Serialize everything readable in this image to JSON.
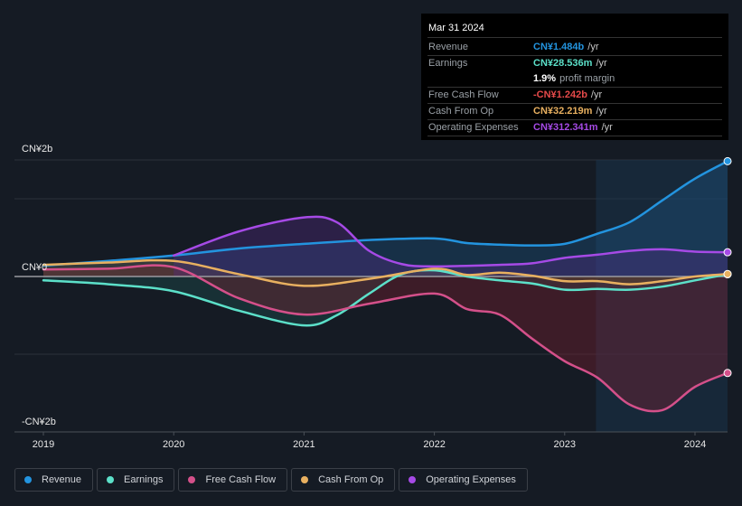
{
  "tooltip": {
    "date": "Mar 31 2024",
    "rows": [
      {
        "label": "Revenue",
        "value": "CN¥1.484b",
        "unit": "/yr",
        "color": "#2394df"
      },
      {
        "label": "Earnings",
        "value": "CN¥28.536m",
        "unit": "/yr",
        "color": "#5ce0c9"
      },
      {
        "label": "",
        "value": "1.9%",
        "unit": "profit margin",
        "color": "#ffffff"
      },
      {
        "label": "Free Cash Flow",
        "value": "-CN¥1.242b",
        "unit": "/yr",
        "color": "#e64a4a"
      },
      {
        "label": "Cash From Op",
        "value": "CN¥32.219m",
        "unit": "/yr",
        "color": "#e8b060"
      },
      {
        "label": "Operating Expenses",
        "value": "CN¥312.341m",
        "unit": "/yr",
        "color": "#a64ae6"
      }
    ]
  },
  "legend": [
    {
      "label": "Revenue",
      "color": "#2394df"
    },
    {
      "label": "Earnings",
      "color": "#5ce0c9"
    },
    {
      "label": "Free Cash Flow",
      "color": "#d4508a"
    },
    {
      "label": "Cash From Op",
      "color": "#e8b060"
    },
    {
      "label": "Operating Expenses",
      "color": "#a64ae6"
    }
  ],
  "chart_data": {
    "type": "area",
    "title": "",
    "xlabel": "",
    "ylabel": "",
    "y_unit": "CN¥ billions",
    "ylim": [
      -2,
      1.5
    ],
    "y_tick_labels": [
      {
        "value": 1.5,
        "label": "CN¥2b"
      },
      {
        "value": 0,
        "label": "CN¥0"
      },
      {
        "value": -2,
        "label": "-CN¥2b"
      }
    ],
    "gridlines": [
      1.5,
      1,
      0,
      -1,
      -2
    ],
    "x_ticks": [
      2019,
      2020,
      2021,
      2022,
      2023,
      2024
    ],
    "xlim": [
      2019,
      2024.25
    ],
    "forecast_shade_start": 2023.24,
    "series": [
      {
        "name": "Revenue",
        "color": "#2394df",
        "points": [
          [
            2019,
            0.14
          ],
          [
            2019.5,
            0.2
          ],
          [
            2020,
            0.27
          ],
          [
            2020.5,
            0.36
          ],
          [
            2021,
            0.42
          ],
          [
            2021.5,
            0.47
          ],
          [
            2022,
            0.49
          ],
          [
            2022.25,
            0.43
          ],
          [
            2022.5,
            0.41
          ],
          [
            2022.75,
            0.4
          ],
          [
            2023,
            0.42
          ],
          [
            2023.25,
            0.55
          ],
          [
            2023.5,
            0.7
          ],
          [
            2023.75,
            0.98
          ],
          [
            2024,
            1.26
          ],
          [
            2024.25,
            1.484
          ]
        ]
      },
      {
        "name": "Earnings",
        "color": "#5ce0c9",
        "points": [
          [
            2019,
            -0.05
          ],
          [
            2019.5,
            -0.1
          ],
          [
            2020,
            -0.19
          ],
          [
            2020.5,
            -0.44
          ],
          [
            2021,
            -0.63
          ],
          [
            2021.25,
            -0.5
          ],
          [
            2021.5,
            -0.22
          ],
          [
            2021.75,
            0.03
          ],
          [
            2022,
            0.08
          ],
          [
            2022.25,
            0.0
          ],
          [
            2022.5,
            -0.05
          ],
          [
            2022.75,
            -0.09
          ],
          [
            2023,
            -0.17
          ],
          [
            2023.25,
            -0.16
          ],
          [
            2023.5,
            -0.17
          ],
          [
            2023.75,
            -0.13
          ],
          [
            2024,
            -0.05
          ],
          [
            2024.25,
            0.0285
          ]
        ]
      },
      {
        "name": "Free Cash Flow",
        "color": "#d4508a",
        "points": [
          [
            2019,
            0.09
          ],
          [
            2019.5,
            0.1
          ],
          [
            2020,
            0.12
          ],
          [
            2020.5,
            -0.28
          ],
          [
            2021,
            -0.49
          ],
          [
            2021.5,
            -0.35
          ],
          [
            2022,
            -0.22
          ],
          [
            2022.25,
            -0.42
          ],
          [
            2022.5,
            -0.49
          ],
          [
            2022.75,
            -0.8
          ],
          [
            2023,
            -1.09
          ],
          [
            2023.25,
            -1.3
          ],
          [
            2023.5,
            -1.65
          ],
          [
            2023.75,
            -1.72
          ],
          [
            2024,
            -1.42
          ],
          [
            2024.25,
            -1.242
          ]
        ]
      },
      {
        "name": "Cash From Op",
        "color": "#e8b060",
        "points": [
          [
            2019,
            0.15
          ],
          [
            2019.5,
            0.18
          ],
          [
            2020,
            0.2
          ],
          [
            2020.5,
            0.03
          ],
          [
            2021,
            -0.12
          ],
          [
            2021.5,
            -0.03
          ],
          [
            2022,
            0.1
          ],
          [
            2022.25,
            0.02
          ],
          [
            2022.5,
            0.05
          ],
          [
            2022.75,
            0.01
          ],
          [
            2023,
            -0.06
          ],
          [
            2023.25,
            -0.06
          ],
          [
            2023.5,
            -0.1
          ],
          [
            2023.75,
            -0.06
          ],
          [
            2024,
            0.0
          ],
          [
            2024.25,
            0.0322
          ]
        ]
      },
      {
        "name": "Operating Expenses",
        "color": "#a64ae6",
        "points": [
          [
            2020,
            0.27
          ],
          [
            2020.5,
            0.58
          ],
          [
            2021,
            0.76
          ],
          [
            2021.25,
            0.7
          ],
          [
            2021.5,
            0.33
          ],
          [
            2021.75,
            0.16
          ],
          [
            2022,
            0.13
          ],
          [
            2022.5,
            0.15
          ],
          [
            2022.75,
            0.17
          ],
          [
            2023,
            0.24
          ],
          [
            2023.25,
            0.28
          ],
          [
            2023.5,
            0.33
          ],
          [
            2023.75,
            0.35
          ],
          [
            2024,
            0.32
          ],
          [
            2024.25,
            0.312
          ]
        ]
      }
    ]
  }
}
